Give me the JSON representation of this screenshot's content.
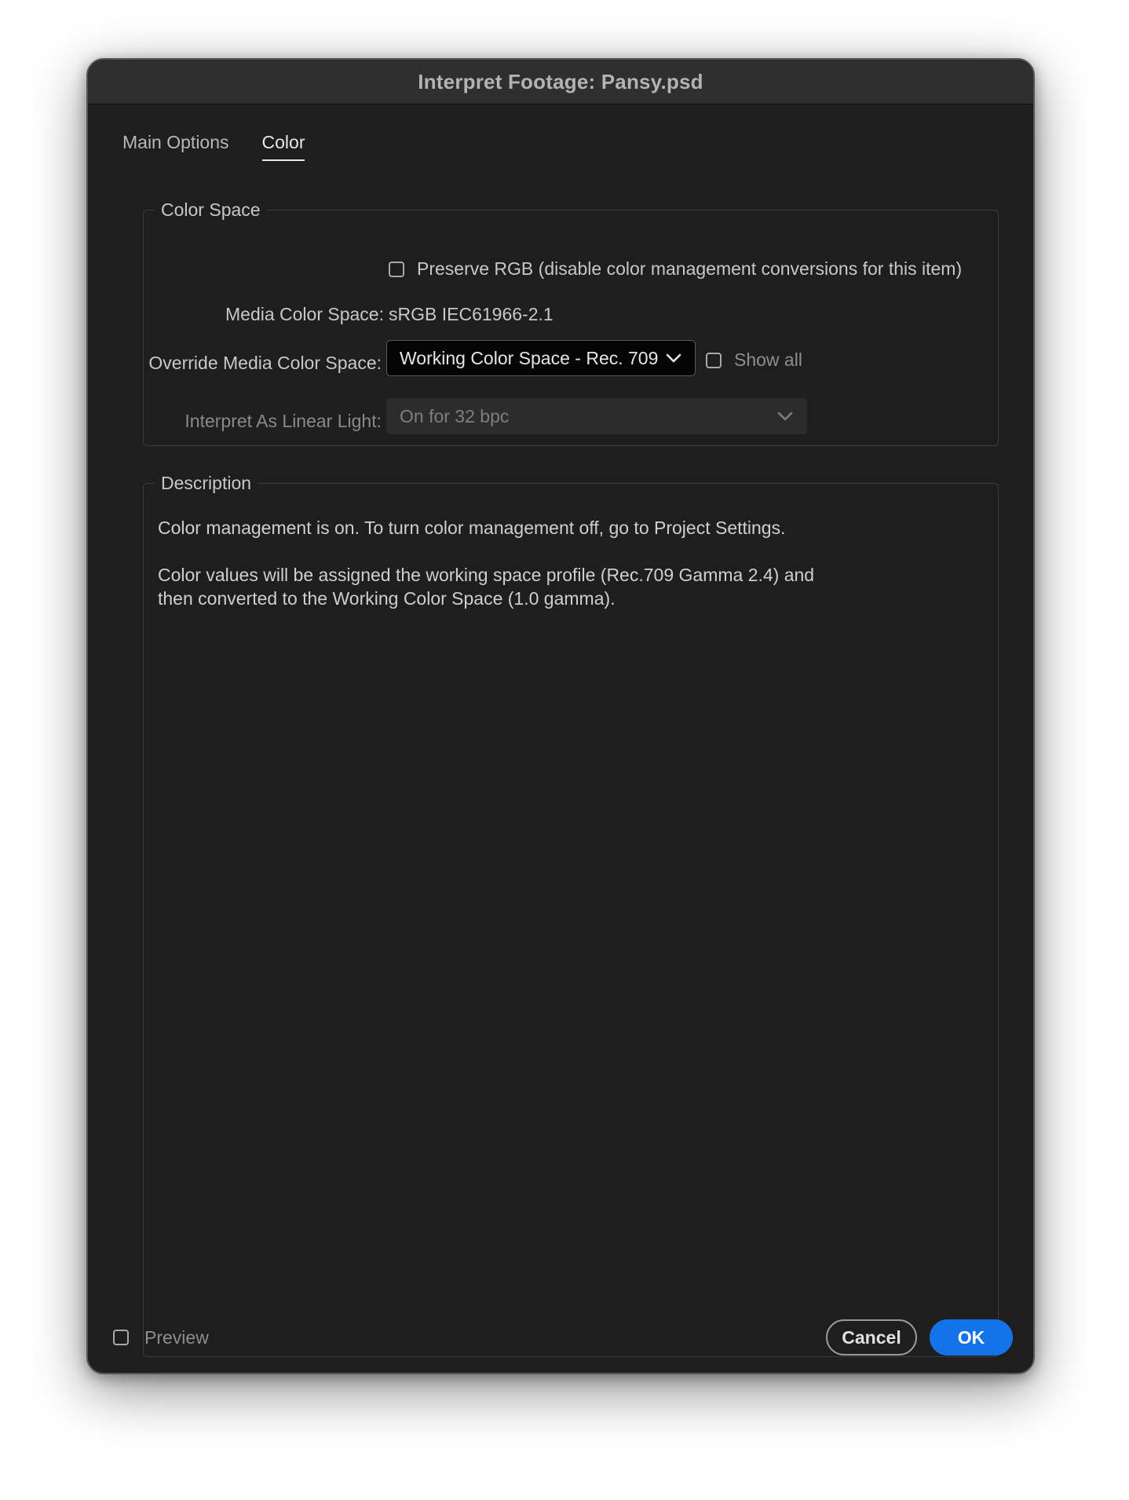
{
  "window": {
    "title": "Interpret Footage: Pansy.psd"
  },
  "tabs": [
    {
      "label": "Main Options",
      "active": false
    },
    {
      "label": "Color",
      "active": true
    }
  ],
  "color_space": {
    "legend": "Color Space",
    "preserve_rgb": {
      "label": "Preserve RGB (disable color management conversions for this item)",
      "checked": false
    },
    "media_color_space": {
      "label": "Media Color Space:",
      "value": "sRGB IEC61966-2.1"
    },
    "override_media_color_space": {
      "label": "Override Media Color Space:",
      "selected": "Working Color Space - Rec. 709",
      "show_all": {
        "label": "Show all",
        "checked": false
      }
    },
    "interpret_as_linear_light": {
      "label": "Interpret As Linear Light:",
      "selected": "On for 32 bpc",
      "disabled": true
    }
  },
  "description": {
    "legend": "Description",
    "line1": "Color management is on. To turn color management off, go to Project Settings.",
    "line2": "Color values will be assigned the working space profile (Rec.709 Gamma 2.4) and",
    "line3": "then converted to the Working Color Space (1.0 gamma)."
  },
  "footer": {
    "preview": {
      "label": "Preview",
      "checked": false
    },
    "cancel_label": "Cancel",
    "ok_label": "OK"
  },
  "colors": {
    "dialog_bg": "#1e1e1e",
    "titlebar_bg": "#2f2f2f",
    "accent": "#1473e6"
  }
}
